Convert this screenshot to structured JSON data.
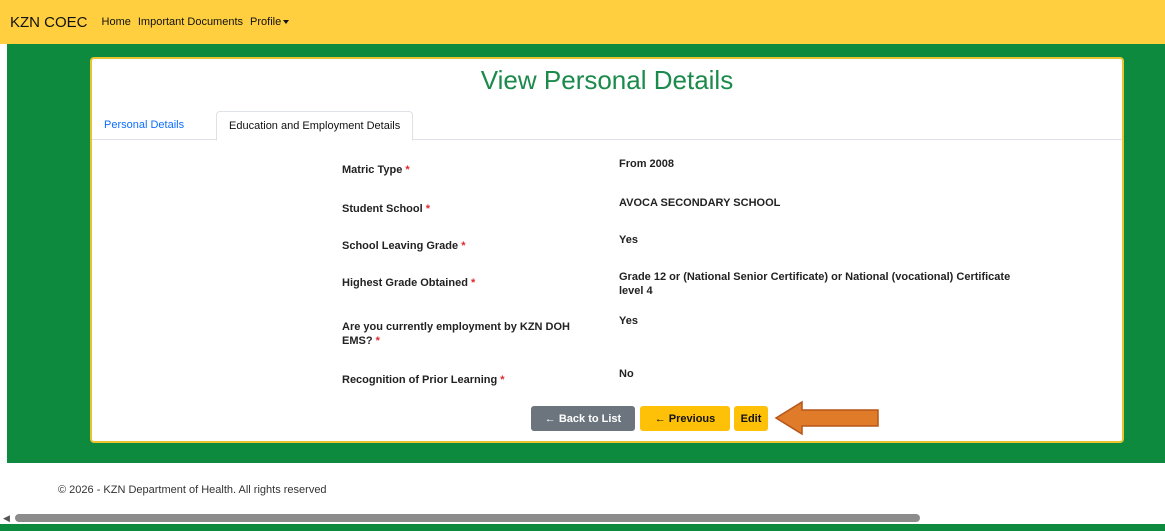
{
  "navbar": {
    "brand": "KZN COEC",
    "links": [
      "Home",
      "Important Documents",
      "Profile"
    ]
  },
  "page": {
    "title": "View Personal Details"
  },
  "tabs": {
    "personal": "Personal Details",
    "education": "Education and Employment Details"
  },
  "fields": [
    {
      "label": "Matric Type",
      "required": "*",
      "value": "From 2008"
    },
    {
      "label": "Student School",
      "required": "*",
      "value": "AVOCA SECONDARY SCHOOL"
    },
    {
      "label": "School Leaving Grade",
      "required": "*",
      "value": "Yes"
    },
    {
      "label": "Highest Grade Obtained",
      "required": "*",
      "value": "Grade 12 or (National Senior Certificate) or National (vocational) Certificate level 4"
    },
    {
      "label": "Are you currently employment by KZN DOH EMS?",
      "required": "*",
      "value": "Yes"
    },
    {
      "label": "Recognition of Prior Learning",
      "required": "*",
      "value": "No"
    }
  ],
  "buttons": {
    "back": "← Back to List",
    "previous": "← Previous",
    "edit": "Edit"
  },
  "footer": {
    "text": "© 2026 - KZN Department of Health. All rights reserved"
  },
  "colors": {
    "navbar": "#ffcf3f",
    "green": "#0d8a3e",
    "title": "#1c8a4c",
    "arrow": "#e07b2a"
  }
}
